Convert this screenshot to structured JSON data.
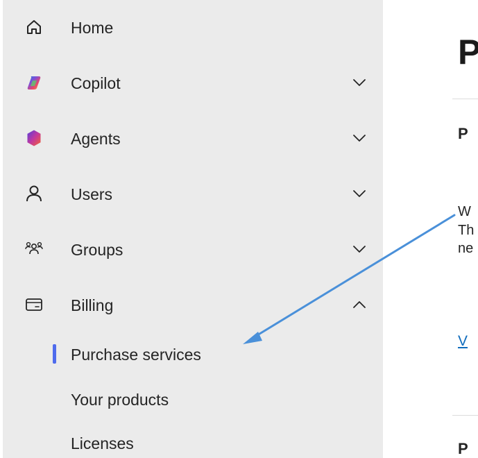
{
  "sidebar": {
    "items": [
      {
        "label": "Home",
        "icon": "home-icon",
        "expandable": false
      },
      {
        "label": "Copilot",
        "icon": "copilot-icon",
        "expandable": true,
        "expanded": false
      },
      {
        "label": "Agents",
        "icon": "agents-icon",
        "expandable": true,
        "expanded": false
      },
      {
        "label": "Users",
        "icon": "user-icon",
        "expandable": true,
        "expanded": false
      },
      {
        "label": "Groups",
        "icon": "groups-icon",
        "expandable": true,
        "expanded": false
      },
      {
        "label": "Billing",
        "icon": "billing-icon",
        "expandable": true,
        "expanded": true
      }
    ],
    "billing_subitems": [
      {
        "label": "Purchase services",
        "active": true
      },
      {
        "label": "Your products",
        "active": false
      },
      {
        "label": "Licenses",
        "active": false
      }
    ]
  },
  "main": {
    "title_fragment": "P",
    "section1_fragment": "P",
    "desc_fragments": [
      "W",
      "Th",
      "ne"
    ],
    "link_fragment": "V",
    "section2_fragment": "P"
  },
  "colors": {
    "sidebar_bg": "#ebebeb",
    "active_indicator": "#4f6bed",
    "link": "#0f6cbd",
    "annotation_arrow": "#4a90d9"
  }
}
